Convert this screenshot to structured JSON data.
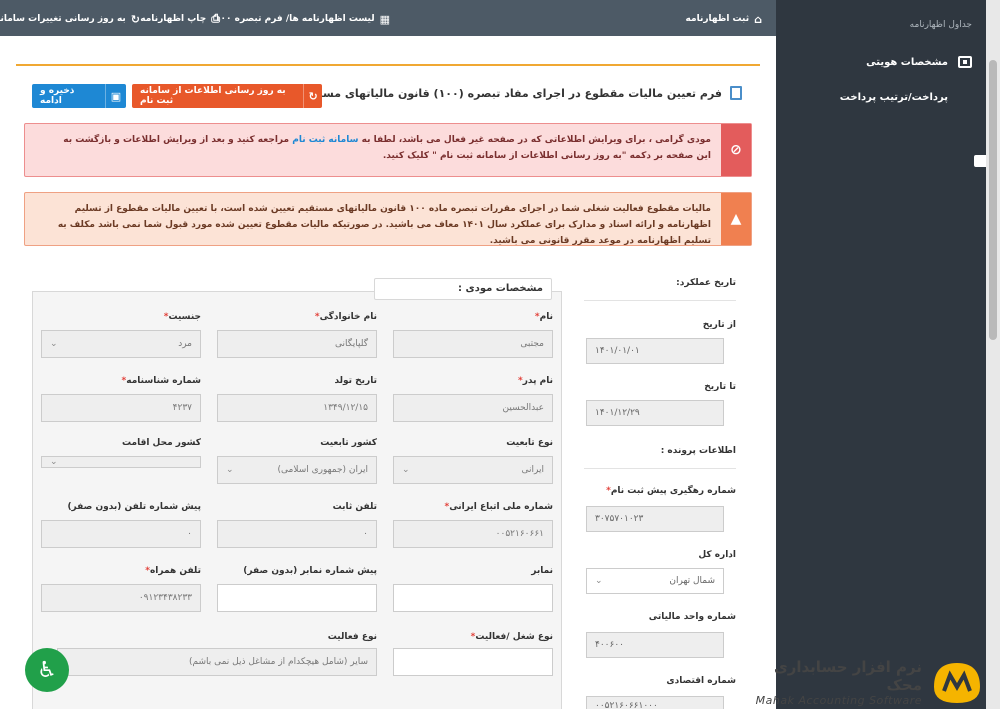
{
  "topbar": {
    "register": "ثبت اظهارنامه",
    "list": "لیست اظهارنامه ها/ فرم تبصره ۱۰۰",
    "print": "چاپ اظهارنامه",
    "update_changes": "به روز رسانی تغییرات سامانه"
  },
  "sidebar": {
    "title": "جداول اظهارنامه",
    "items": [
      {
        "label": "مشخصات هویتی",
        "icon": "id-card-icon"
      },
      {
        "label": "پرداخت/ترتیب پرداخت",
        "icon": "credit-card-icon"
      }
    ]
  },
  "form": {
    "title": "فرم تعیین مالیات مقطوع در اجرای مفاد تبصره (۱۰۰) قانون مالیاتهای مستقیم",
    "update_button": "به روز رسانی اطلاعات از سامانه ثبت نام",
    "save_button": "ذخیره و ادامه"
  },
  "alerts": {
    "danger_part1": "مودی گرامی ، برای ویرایش اطلاعاتی که در صفحه غیر فعال می باشد، لطفا به",
    "danger_link": "سامانه ثبت نام",
    "danger_part2": "مراجعه کنید و بعد از ویرایش اطلاعات و بازگشت به این صفحه بر دکمه \"به روز رسانی اطلاعات از سامانه ثبت نام \" کلیک کنید.",
    "warning": "مالیات مقطوع فعالیت شغلی شما در اجرای مقررات تبصره ماده ۱۰۰ قانون مالیاتهای مستقیم تعیین شده است، با تعیین مالیات مقطوع از تسلیم اظهارنامه و ارائه اسناد و مدارک برای عملکرد سال ۱۴۰۱ معاف می باشید. در صورتیکه مالیات مقطوع تعیین شده مورد قبول شما نمی باشد مکلف به تسلیم اظهارنامه در موعد مقرر قانونی می باشید."
  },
  "period": {
    "heading": "تاریخ عملکرد:",
    "from_label": "از تاریخ",
    "from_value": "۱۴۰۱/۰۱/۰۱",
    "to_label": "تا تاریخ",
    "to_value": "۱۴۰۱/۱۲/۲۹"
  },
  "case": {
    "heading": "اطلاعات پرونده :",
    "tracking_label": "شماره رهگیری پیش ثبت نام",
    "tracking_value": "۳۰۷۵۷۰۱۰۲۳",
    "office_label": "اداره کل",
    "office_value": "شمال تهران",
    "unit_label": "شماره واحد مالیاتی",
    "unit_value": "۴۰۰۶۰۰",
    "economic_label": "شماره اقتصادی",
    "economic_value": "۰۰۵۲۱۶۰۶۶۱۰۰۰"
  },
  "subject": {
    "heading": "مشخصات مودی :",
    "fields": {
      "name": {
        "label": "نام",
        "value": "مجتبی"
      },
      "family": {
        "label": "نام خانوادگی",
        "value": "گلپایگانی"
      },
      "gender": {
        "label": "جنسیت",
        "value": "مرد"
      },
      "father": {
        "label": "نام پدر",
        "value": "عبدالحسین"
      },
      "birth": {
        "label": "تاریخ تولد",
        "value": "۱۳۴۹/۱۲/۱۵"
      },
      "id_no": {
        "label": "شماره شناسنامه",
        "value": "۴۲۳۷"
      },
      "nationality_type": {
        "label": "نوع تابعیت",
        "value": "ایرانی"
      },
      "nationality_country": {
        "label": "کشور تابعیت",
        "value": "ایران (جمهوری اسلامی)"
      },
      "residence_country": {
        "label": "کشور محل اقامت",
        "value": ""
      },
      "national_id": {
        "label": "شماره ملی اتباع ایرانی",
        "value": "۰۰۵۲۱۶۰۶۶۱"
      },
      "phone": {
        "label": "تلفن ثابت",
        "value": "۰"
      },
      "phone_prefix": {
        "label": "پیش شماره تلفن (بدون صفر)",
        "value": "۰"
      },
      "fax": {
        "label": "نمابر",
        "value": ""
      },
      "fax_prefix": {
        "label": "پیش شماره نمابر (بدون صفر)",
        "value": ""
      },
      "mobile": {
        "label": "تلفن همراه",
        "value": "۰۹۱۲۳۴۳۸۲۳۳"
      },
      "job_type": {
        "label": "نوع شغل /فعالیت",
        "value": ""
      },
      "activity_type": {
        "label": "نوع فعالیت",
        "value": "سایر (شامل هیچکدام از مشاغل ذیل نمی باشم)"
      }
    }
  },
  "logo": {
    "fa": "نرم افزار حسابداری محک",
    "en": "Mahak Accounting Software"
  },
  "colors": {
    "sidebar": "#2f3740",
    "topbar": "#4d5a66",
    "save": "#1e88d4",
    "update": "#e8582a",
    "danger": "#e35c5c",
    "warning": "#f08050",
    "accessibility": "#21a04a"
  }
}
